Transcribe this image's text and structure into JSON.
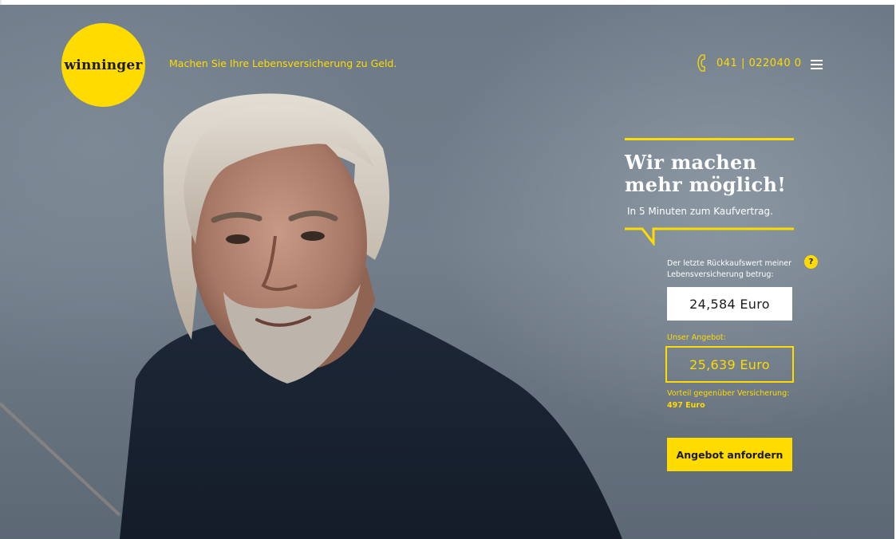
{
  "header": {
    "logo_text": "winninger",
    "tagline": "Machen Sie Ihre Lebensversicherung zu Geld.",
    "phone": "041 | 022040 0",
    "phone_icon": "phone-icon",
    "menu_icon": "hamburger-menu-icon"
  },
  "hero": {
    "headline_line1": "Wir machen",
    "headline_line2": "mehr möglich!",
    "subline": "In 5 Minuten zum Kaufvertrag."
  },
  "calculator": {
    "label": "Der letzte Rückkaufswert meiner Lebensversicherung betrug:",
    "help_symbol": "?",
    "surrender_value": "24,584 Euro",
    "offer_label": "Unser Angebot:",
    "offer_value": "25,639 Euro",
    "advantage_prefix": "Vorteil gegenüber Versicherung:",
    "advantage_value": "497 Euro",
    "cta_label": "Angebot anfordern"
  },
  "colors": {
    "accent": "#ffdb00",
    "text_dark": "#1c1c1c",
    "text_light": "#ffffff"
  }
}
